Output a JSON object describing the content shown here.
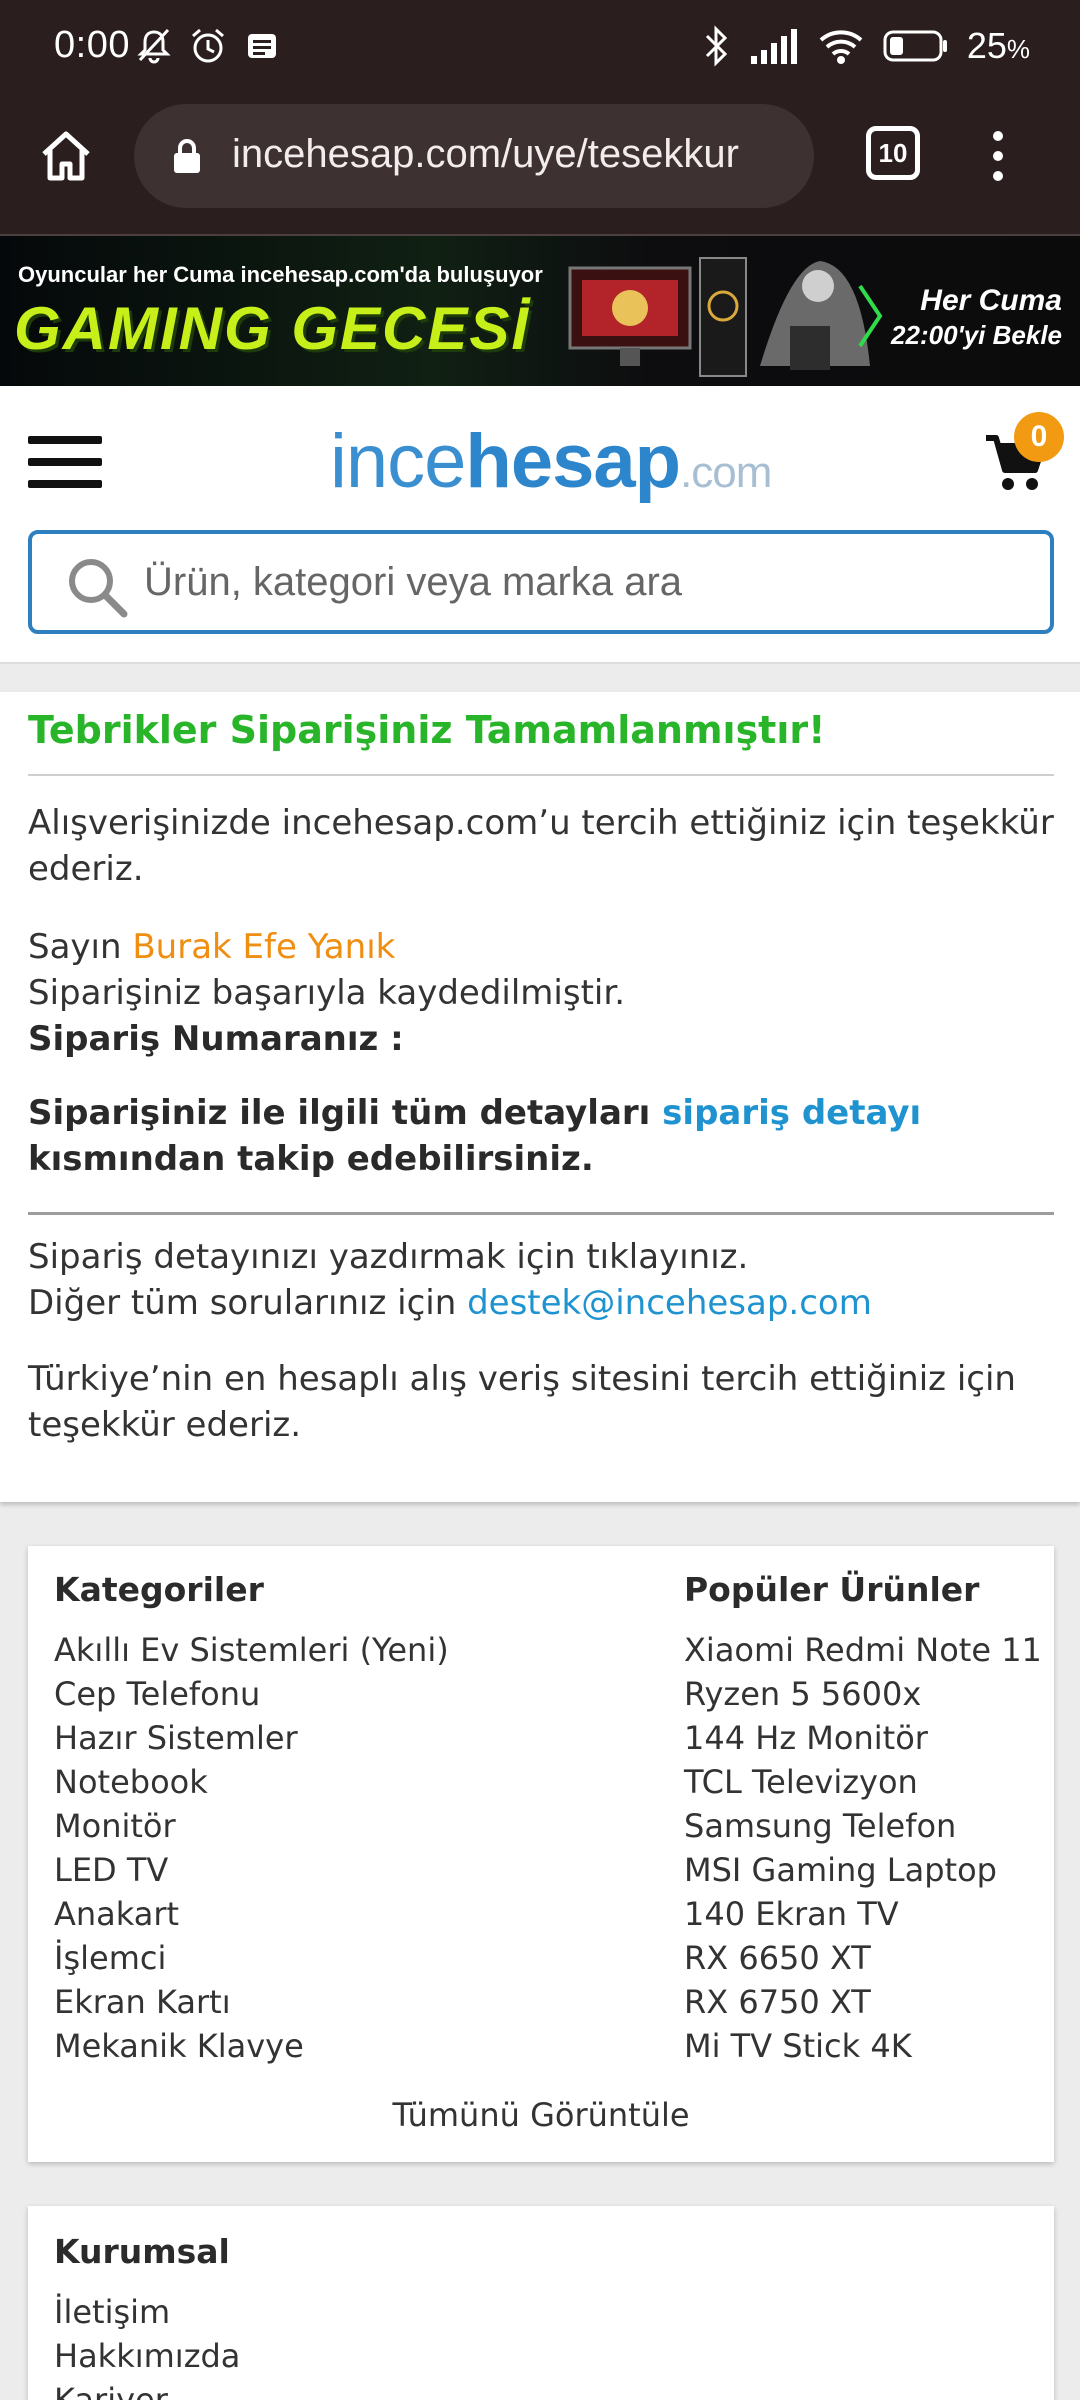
{
  "status_bar": {
    "time": "0:00",
    "battery": "25",
    "battery_unit": "%"
  },
  "browser": {
    "url": "incehesap.com/uye/tesekkur",
    "tab_count": "10"
  },
  "banner": {
    "tagline": "Oyuncular her Cuma incehesap.com'da buluşuyor",
    "headline": "GAMING GECESİ",
    "right_line1": "Her Cuma",
    "right_line2": "22:00'yi Bekle"
  },
  "header": {
    "logo_part1": "ince",
    "logo_part2": "hesap",
    "logo_part3": ".com",
    "cart_count": "0",
    "search_placeholder": "Ürün, kategori veya marka ara"
  },
  "confirmation": {
    "title": "Tebrikler Siparişiniz Tamamlanmıştır!",
    "thanks_text": "Alışverişinizde incehesap.com’u tercih ettiğiniz için teşekkür ederiz.",
    "greeting_prefix": "Sayın",
    "customer_name": "Burak Efe Yanık",
    "saved_text": "Siparişiniz başarıyla kaydedilmiştir.",
    "order_number_label": "Sipariş Numaranız :",
    "details_text_1": "Siparişiniz ile ilgili tüm detayları",
    "details_link": "sipariş detayı",
    "details_text_2": "kısmından takip edebilirsiniz.",
    "print_text": "Sipariş detayınızı yazdırmak için tıklayınız.",
    "contact_prefix": "Diğer tüm sorularınız için",
    "contact_email": "destek@incehesap.com",
    "closing_text": "Türkiye’nin en hesaplı alış veriş sitesini tercih ettiğiniz için teşekkür ederiz."
  },
  "footer": {
    "categories_title": "Kategoriler",
    "categories": [
      "Akıllı Ev Sistemleri (Yeni)",
      "Cep Telefonu",
      "Hazır Sistemler",
      "Notebook",
      "Monitör",
      "LED TV",
      "Anakart",
      "İşlemci",
      "Ekran Kartı",
      "Mekanik Klavye"
    ],
    "popular_title": "Popüler Ürünler",
    "popular": [
      "Xiaomi Redmi Note 11",
      "Ryzen 5 5600x",
      "144 Hz Monitör",
      "TCL Televizyon",
      "Samsung Telefon",
      "MSI Gaming Laptop",
      "140 Ekran TV",
      "RX 6650 XT",
      "RX 6750 XT",
      "Mi TV Stick 4K"
    ],
    "show_all": "Tümünü Görüntüle",
    "corporate_title": "Kurumsal",
    "corporate": [
      "İletişim",
      "Hakkımızda",
      "Kariyer"
    ]
  },
  "colors": {
    "success": "#29b529",
    "accent_blue": "#1e93d0",
    "name_orange": "#ef8e10",
    "badge": "#f29a12"
  }
}
